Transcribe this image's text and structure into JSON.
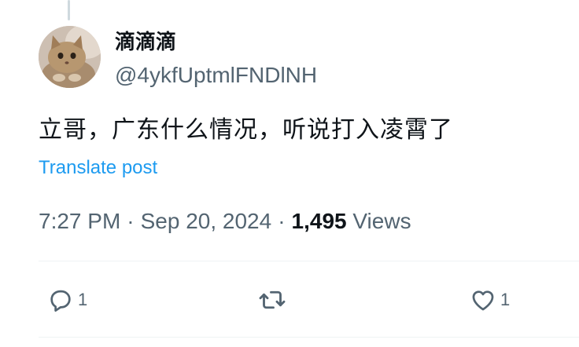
{
  "tweet": {
    "author": {
      "display_name": "滴滴滴",
      "handle": "@4ykfUptmlFNDlNH",
      "avatar_icon": "cat-avatar"
    },
    "text": "立哥，广东什么情况，听说打入凌霄了",
    "translate_label": "Translate post",
    "meta": {
      "time": "7:27 PM",
      "separator": "·",
      "date": "Sep 20, 2024",
      "views_count": "1,495",
      "views_label": "Views"
    },
    "actions": {
      "reply": {
        "icon": "reply-icon",
        "count": "1"
      },
      "repost": {
        "icon": "repost-icon"
      },
      "like": {
        "icon": "heart-icon",
        "count": "1"
      }
    }
  },
  "colors": {
    "text": "#0f1419",
    "secondary": "#536471",
    "link": "#1d9bf0",
    "divider": "#eff3f4",
    "thread_line": "#cfd9de"
  }
}
